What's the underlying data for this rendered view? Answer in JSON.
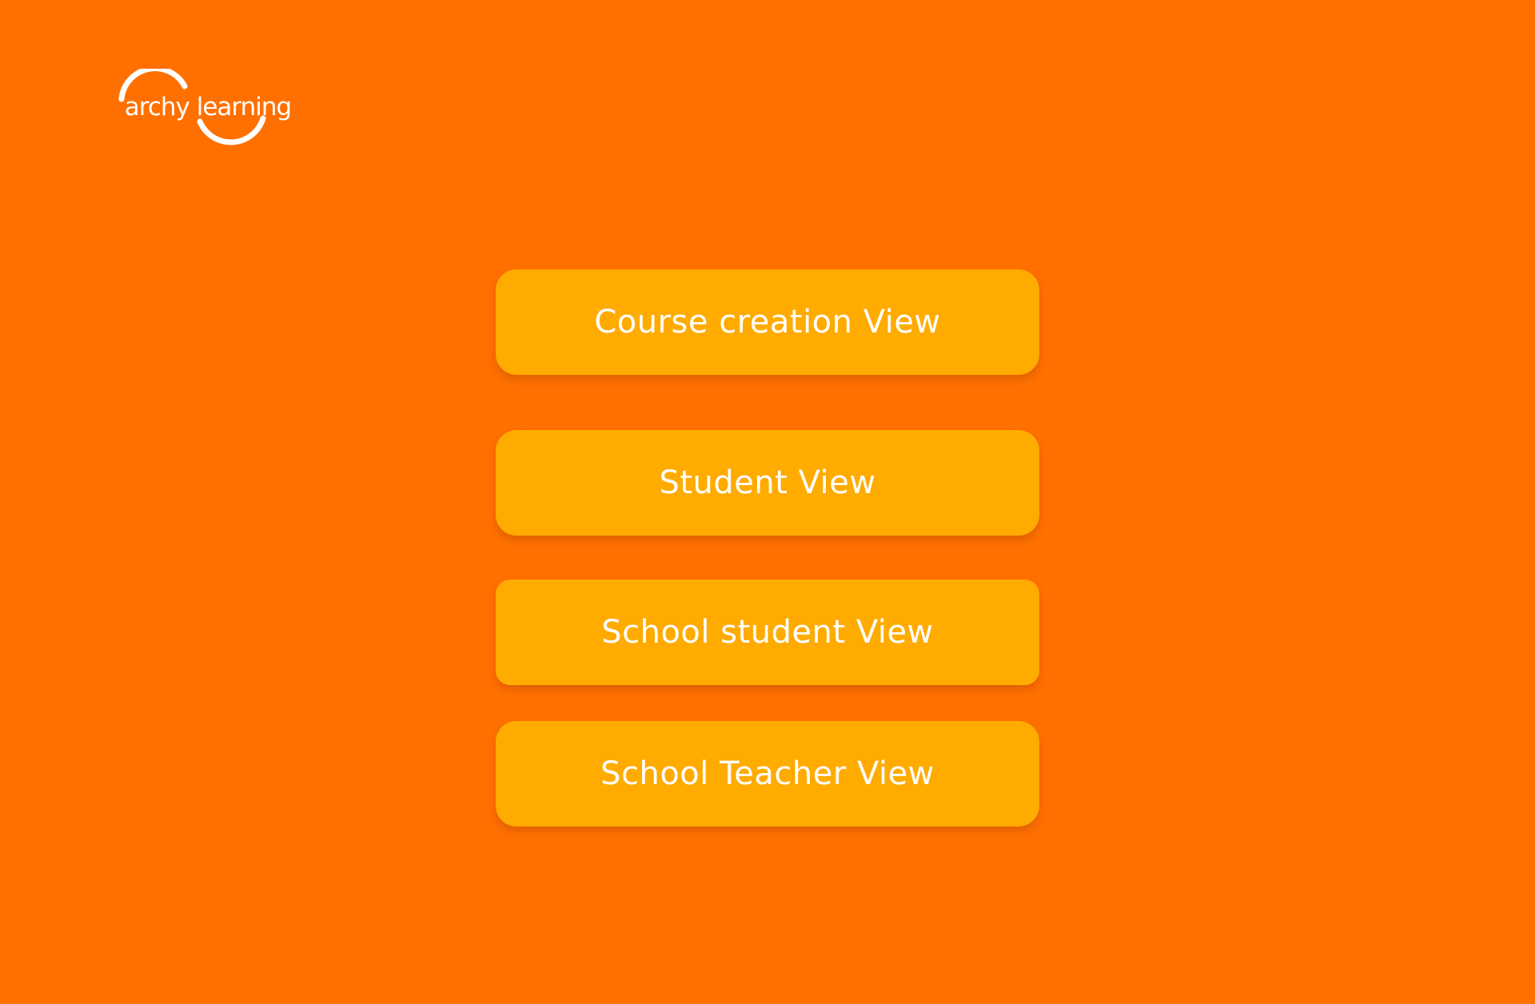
{
  "brand": {
    "logo_text": "archy learning",
    "logo_color": "#FFFFFF"
  },
  "theme": {
    "background": "#FF7000",
    "button_color": "#FFAB00",
    "button_text_color": "#FFFFFF"
  },
  "views": [
    {
      "label": "Course creation View"
    },
    {
      "label": "Student View"
    },
    {
      "label": "School student View"
    },
    {
      "label": "School Teacher View"
    }
  ]
}
